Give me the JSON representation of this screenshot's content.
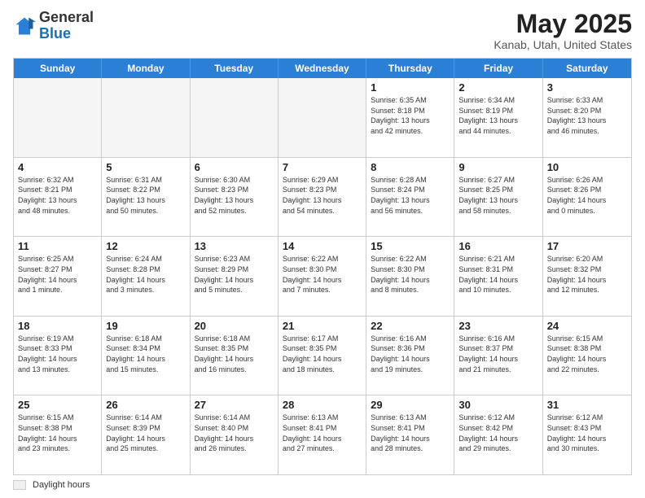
{
  "header": {
    "logo_general": "General",
    "logo_blue": "Blue",
    "month_year": "May 2025",
    "location": "Kanab, Utah, United States"
  },
  "day_headers": [
    "Sunday",
    "Monday",
    "Tuesday",
    "Wednesday",
    "Thursday",
    "Friday",
    "Saturday"
  ],
  "rows": [
    {
      "cells": [
        {
          "day": "",
          "info": "",
          "empty": true
        },
        {
          "day": "",
          "info": "",
          "empty": true
        },
        {
          "day": "",
          "info": "",
          "empty": true
        },
        {
          "day": "",
          "info": "",
          "empty": true
        },
        {
          "day": "1",
          "info": "Sunrise: 6:35 AM\nSunset: 8:18 PM\nDaylight: 13 hours\nand 42 minutes.",
          "empty": false
        },
        {
          "day": "2",
          "info": "Sunrise: 6:34 AM\nSunset: 8:19 PM\nDaylight: 13 hours\nand 44 minutes.",
          "empty": false
        },
        {
          "day": "3",
          "info": "Sunrise: 6:33 AM\nSunset: 8:20 PM\nDaylight: 13 hours\nand 46 minutes.",
          "empty": false
        }
      ]
    },
    {
      "cells": [
        {
          "day": "4",
          "info": "Sunrise: 6:32 AM\nSunset: 8:21 PM\nDaylight: 13 hours\nand 48 minutes.",
          "empty": false
        },
        {
          "day": "5",
          "info": "Sunrise: 6:31 AM\nSunset: 8:22 PM\nDaylight: 13 hours\nand 50 minutes.",
          "empty": false
        },
        {
          "day": "6",
          "info": "Sunrise: 6:30 AM\nSunset: 8:23 PM\nDaylight: 13 hours\nand 52 minutes.",
          "empty": false
        },
        {
          "day": "7",
          "info": "Sunrise: 6:29 AM\nSunset: 8:23 PM\nDaylight: 13 hours\nand 54 minutes.",
          "empty": false
        },
        {
          "day": "8",
          "info": "Sunrise: 6:28 AM\nSunset: 8:24 PM\nDaylight: 13 hours\nand 56 minutes.",
          "empty": false
        },
        {
          "day": "9",
          "info": "Sunrise: 6:27 AM\nSunset: 8:25 PM\nDaylight: 13 hours\nand 58 minutes.",
          "empty": false
        },
        {
          "day": "10",
          "info": "Sunrise: 6:26 AM\nSunset: 8:26 PM\nDaylight: 14 hours\nand 0 minutes.",
          "empty": false
        }
      ]
    },
    {
      "cells": [
        {
          "day": "11",
          "info": "Sunrise: 6:25 AM\nSunset: 8:27 PM\nDaylight: 14 hours\nand 1 minute.",
          "empty": false
        },
        {
          "day": "12",
          "info": "Sunrise: 6:24 AM\nSunset: 8:28 PM\nDaylight: 14 hours\nand 3 minutes.",
          "empty": false
        },
        {
          "day": "13",
          "info": "Sunrise: 6:23 AM\nSunset: 8:29 PM\nDaylight: 14 hours\nand 5 minutes.",
          "empty": false
        },
        {
          "day": "14",
          "info": "Sunrise: 6:22 AM\nSunset: 8:30 PM\nDaylight: 14 hours\nand 7 minutes.",
          "empty": false
        },
        {
          "day": "15",
          "info": "Sunrise: 6:22 AM\nSunset: 8:30 PM\nDaylight: 14 hours\nand 8 minutes.",
          "empty": false
        },
        {
          "day": "16",
          "info": "Sunrise: 6:21 AM\nSunset: 8:31 PM\nDaylight: 14 hours\nand 10 minutes.",
          "empty": false
        },
        {
          "day": "17",
          "info": "Sunrise: 6:20 AM\nSunset: 8:32 PM\nDaylight: 14 hours\nand 12 minutes.",
          "empty": false
        }
      ]
    },
    {
      "cells": [
        {
          "day": "18",
          "info": "Sunrise: 6:19 AM\nSunset: 8:33 PM\nDaylight: 14 hours\nand 13 minutes.",
          "empty": false
        },
        {
          "day": "19",
          "info": "Sunrise: 6:18 AM\nSunset: 8:34 PM\nDaylight: 14 hours\nand 15 minutes.",
          "empty": false
        },
        {
          "day": "20",
          "info": "Sunrise: 6:18 AM\nSunset: 8:35 PM\nDaylight: 14 hours\nand 16 minutes.",
          "empty": false
        },
        {
          "day": "21",
          "info": "Sunrise: 6:17 AM\nSunset: 8:35 PM\nDaylight: 14 hours\nand 18 minutes.",
          "empty": false
        },
        {
          "day": "22",
          "info": "Sunrise: 6:16 AM\nSunset: 8:36 PM\nDaylight: 14 hours\nand 19 minutes.",
          "empty": false
        },
        {
          "day": "23",
          "info": "Sunrise: 6:16 AM\nSunset: 8:37 PM\nDaylight: 14 hours\nand 21 minutes.",
          "empty": false
        },
        {
          "day": "24",
          "info": "Sunrise: 6:15 AM\nSunset: 8:38 PM\nDaylight: 14 hours\nand 22 minutes.",
          "empty": false
        }
      ]
    },
    {
      "cells": [
        {
          "day": "25",
          "info": "Sunrise: 6:15 AM\nSunset: 8:38 PM\nDaylight: 14 hours\nand 23 minutes.",
          "empty": false
        },
        {
          "day": "26",
          "info": "Sunrise: 6:14 AM\nSunset: 8:39 PM\nDaylight: 14 hours\nand 25 minutes.",
          "empty": false
        },
        {
          "day": "27",
          "info": "Sunrise: 6:14 AM\nSunset: 8:40 PM\nDaylight: 14 hours\nand 26 minutes.",
          "empty": false
        },
        {
          "day": "28",
          "info": "Sunrise: 6:13 AM\nSunset: 8:41 PM\nDaylight: 14 hours\nand 27 minutes.",
          "empty": false
        },
        {
          "day": "29",
          "info": "Sunrise: 6:13 AM\nSunset: 8:41 PM\nDaylight: 14 hours\nand 28 minutes.",
          "empty": false
        },
        {
          "day": "30",
          "info": "Sunrise: 6:12 AM\nSunset: 8:42 PM\nDaylight: 14 hours\nand 29 minutes.",
          "empty": false
        },
        {
          "day": "31",
          "info": "Sunrise: 6:12 AM\nSunset: 8:43 PM\nDaylight: 14 hours\nand 30 minutes.",
          "empty": false
        }
      ]
    }
  ],
  "footer": {
    "legend_label": "Daylight hours"
  }
}
